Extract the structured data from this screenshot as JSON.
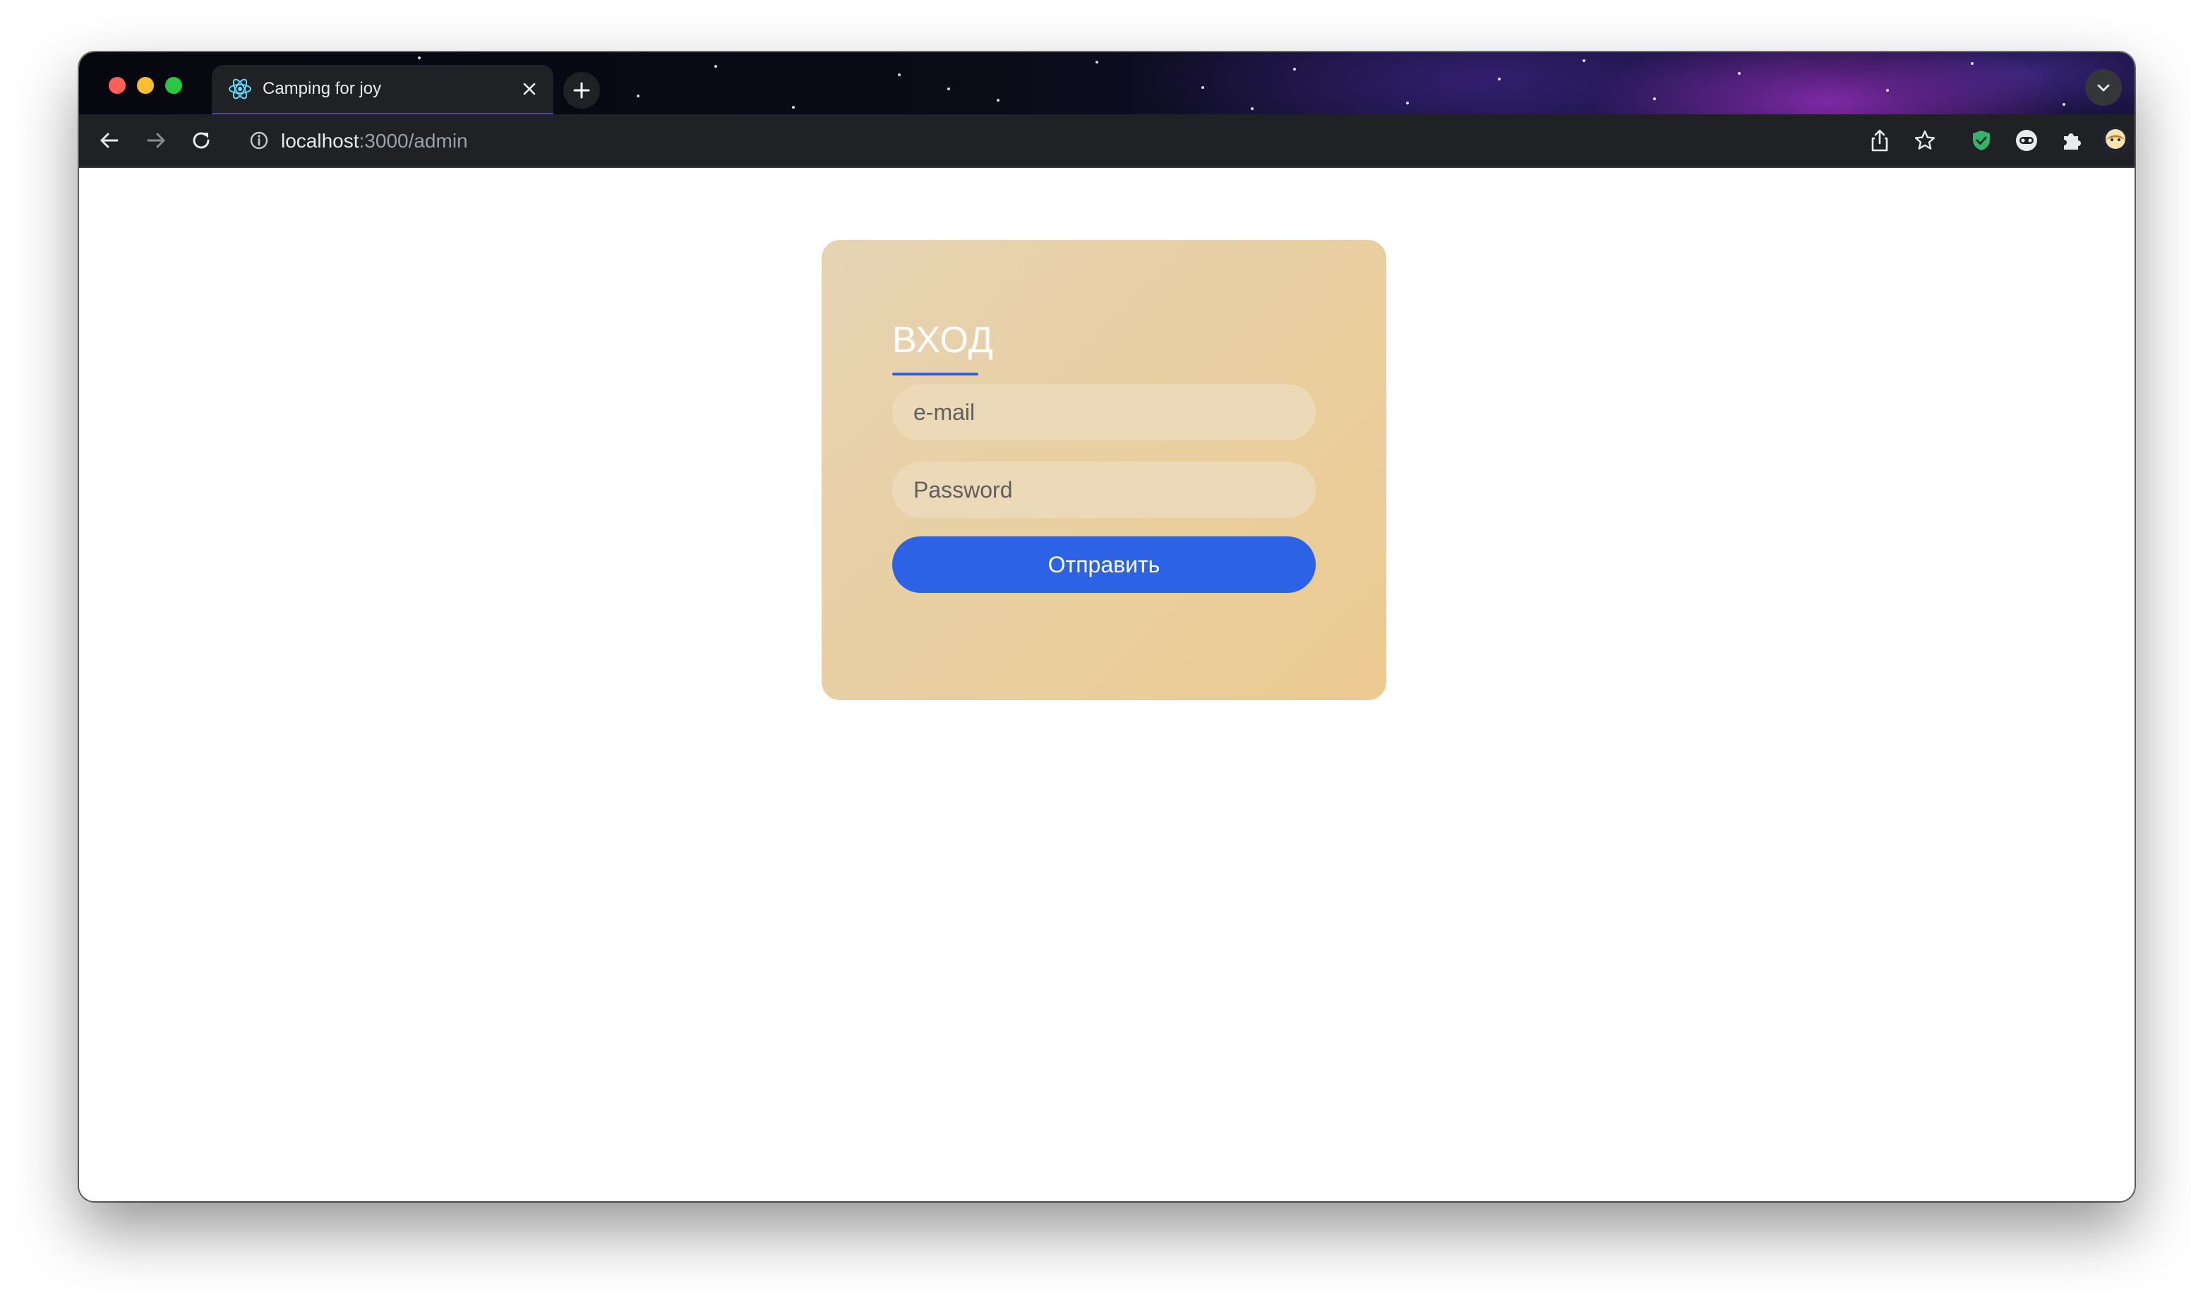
{
  "browser": {
    "tab_title": "Camping for joy",
    "url_host": "localhost",
    "url_rest": ":3000/admin"
  },
  "login": {
    "title": "ВХОД",
    "email_placeholder": "e-mail",
    "password_placeholder": "Password",
    "submit_label": "Отправить"
  },
  "colors": {
    "accent": "#2c63e6",
    "card_bg": "#e9cfa0",
    "traffic_red": "#ff5f57",
    "traffic_yellow": "#febc2e",
    "traffic_green": "#28c840"
  }
}
